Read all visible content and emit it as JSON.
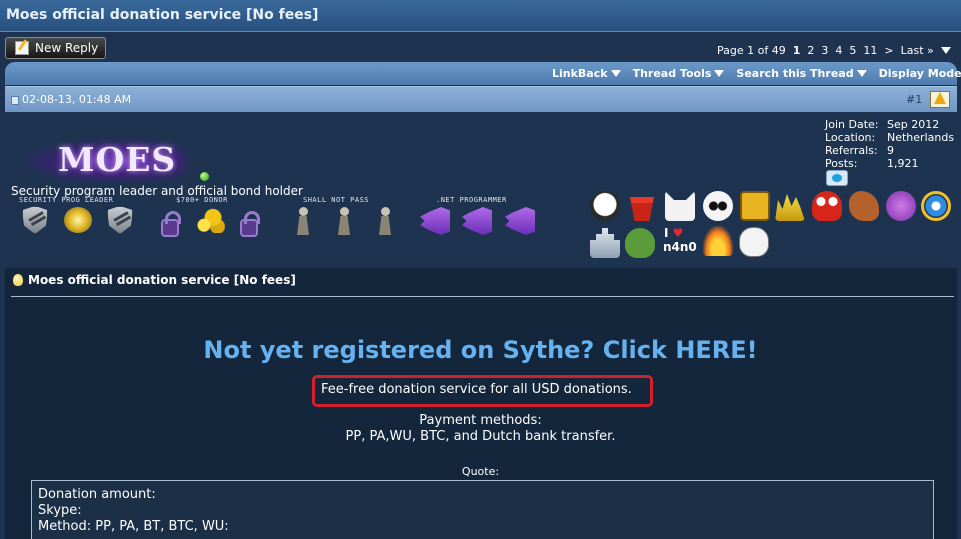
{
  "window": {
    "title": "Moes official donation service [No fees]"
  },
  "reply_button": {
    "label": "New Reply"
  },
  "pagination": {
    "label": "Page 1 of 49",
    "pages": [
      "1",
      "2",
      "3",
      "4",
      "5",
      "11",
      ">",
      "Last »"
    ]
  },
  "toolbar": {
    "menus": [
      "LinkBack",
      "Thread Tools",
      "Search this Thread",
      "Display Modes"
    ]
  },
  "post": {
    "date": "02-08-13, 01:48 AM",
    "number": "#1"
  },
  "user": {
    "name": "MOES",
    "title": "Security program leader and official bond holder",
    "join_date_label": "Join Date:",
    "join_date": "Sep 2012",
    "location_label": "Location:",
    "location": "Netherlands",
    "referrals_label": "Referrals:",
    "referrals": "9",
    "posts_label": "Posts:",
    "posts": "1,921",
    "award_groups": [
      "SECURITY PROG LEADER",
      "$700+ DONOR",
      "SHALL NOT PASS",
      ".NET PROGRAMMER"
    ],
    "n4n0_text": "n4n0"
  },
  "thread": {
    "title": "Moes official donation service [No fees]",
    "headline": "Not yet registered on Sythe? Click HERE!",
    "fee_text": "Fee-free donation service for all USD donations.",
    "payment_label": "Payment methods:",
    "payment_methods": "PP, PA,WU, BTC, and Dutch bank transfer.",
    "quote_label": "Quote:",
    "quote_lines": [
      "Donation amount:",
      "Skype:",
      "Method: PP, PA, BT, BTC, WU:"
    ]
  },
  "colors": {
    "background": "#1d3350",
    "headline": "#66b2f0",
    "highlight_border": "#d4202a"
  }
}
